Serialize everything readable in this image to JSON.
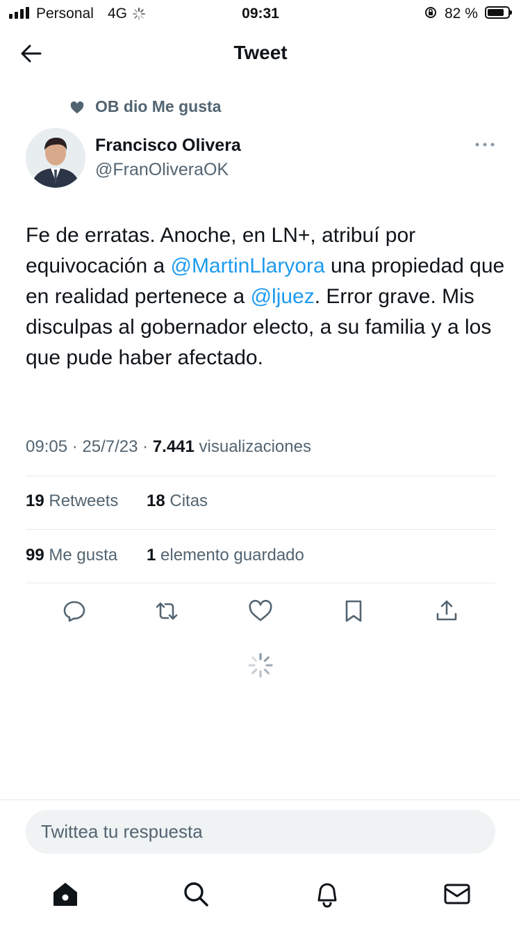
{
  "status_bar": {
    "carrier": "Personal",
    "network": "4G",
    "time": "09:31",
    "battery_percent": "82 %",
    "battery_level": 0.82
  },
  "header": {
    "title": "Tweet",
    "back_icon": "back-arrow-icon"
  },
  "liked_by": {
    "icon": "heart-filled-icon",
    "text": "OB dio Me gusta"
  },
  "author": {
    "name": "Francisco Olivera",
    "handle": "@FranOliveraOK",
    "more_icon": "more-horizontal-icon"
  },
  "tweet": {
    "body": [
      {
        "text": "Fe de erratas. Anoche, en LN+, atribuí por equivocación a ",
        "type": "text"
      },
      {
        "text": "@MartinLlaryora",
        "type": "mention"
      },
      {
        "text": " una propiedad que en realidad pertenece a ",
        "type": "text"
      },
      {
        "text": "@ljuez",
        "type": "mention"
      },
      {
        "text": ". Error grave. Mis disculpas al gobernador electo, a su familia y a los que pude haber afectado.",
        "type": "text"
      }
    ],
    "time": "09:05",
    "date": "25/7/23",
    "views_count": "7.441",
    "views_label": "visualizaciones"
  },
  "stats": {
    "retweets_count": "19",
    "retweets_label": "Retweets",
    "quotes_count": "18",
    "quotes_label": "Citas",
    "likes_count": "99",
    "likes_label": "Me gusta",
    "bookmarks_count": "1",
    "bookmarks_label": "elemento guardado"
  },
  "actions": [
    "reply-icon",
    "retweet-icon",
    "like-icon",
    "bookmark-icon",
    "share-icon"
  ],
  "reply": {
    "placeholder": "Twittea tu respuesta"
  },
  "bottom_nav": [
    "home-icon",
    "search-icon",
    "notifications-icon",
    "messages-icon"
  ],
  "colors": {
    "link": "#1d9bf0",
    "secondary_text": "#536471",
    "primary_text": "#0f1419",
    "reply_bg": "#eff3f4"
  }
}
